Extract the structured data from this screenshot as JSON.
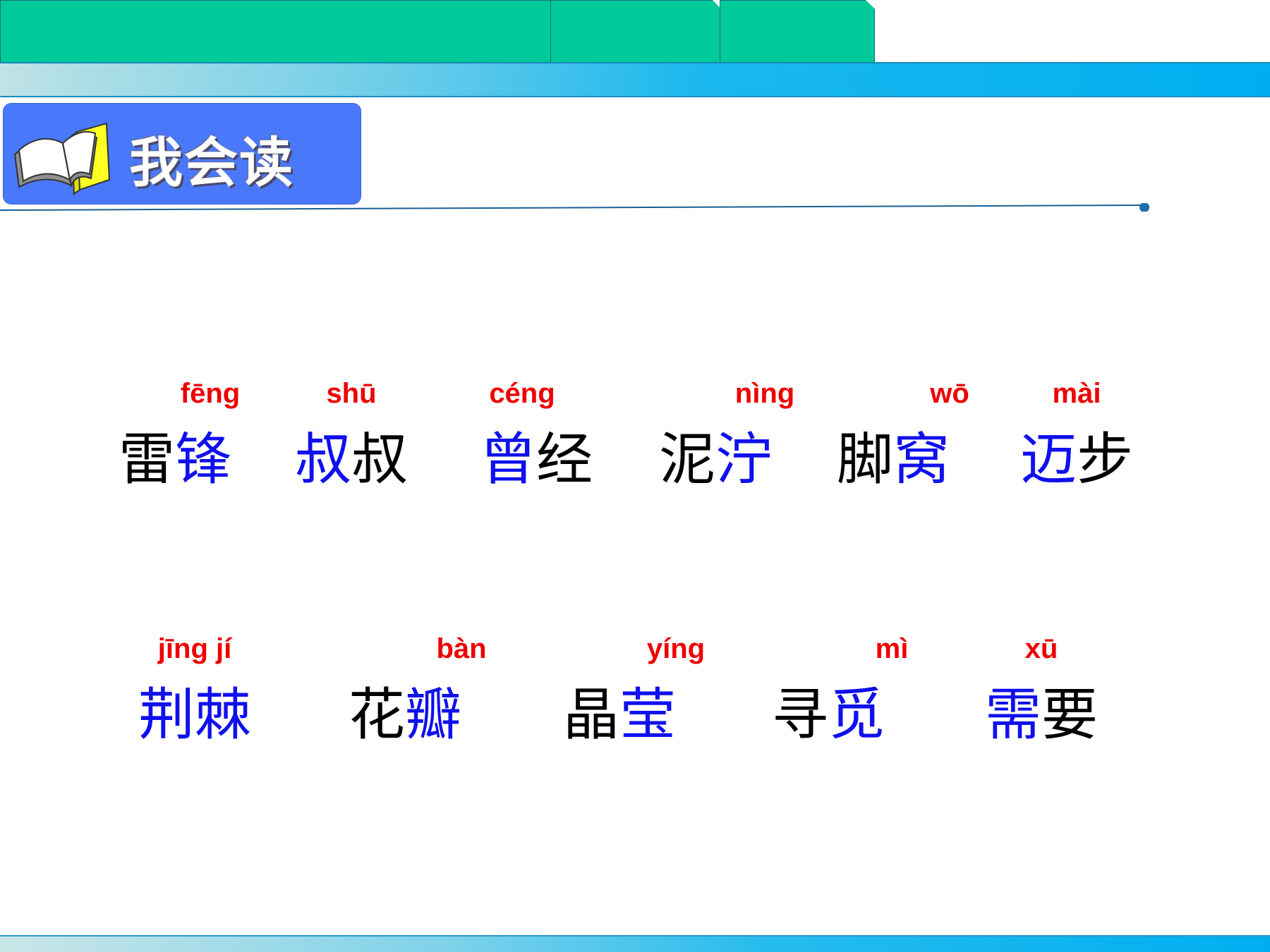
{
  "header": {
    "title": "我会读",
    "colors": {
      "tab": "#00c99a",
      "bar": "#00aef0",
      "header_bg": "#4a78fb",
      "pinyin": "#ee0000",
      "new_char": "#1010ee"
    }
  },
  "rows": [
    [
      {
        "pinyin": "fēng",
        "chars": [
          {
            "t": "雷",
            "new": false
          },
          {
            "t": "锋",
            "new": true
          }
        ]
      },
      {
        "pinyin": "shū",
        "chars": [
          {
            "t": "叔",
            "new": true
          },
          {
            "t": "叔",
            "new": false
          }
        ]
      },
      {
        "pinyin": "céng",
        "chars": [
          {
            "t": "曾",
            "new": true
          },
          {
            "t": "经",
            "new": false
          }
        ]
      },
      {
        "pinyin": "nìng",
        "chars": [
          {
            "t": "泥",
            "new": false
          },
          {
            "t": "泞",
            "new": true
          }
        ]
      },
      {
        "pinyin": "wō",
        "chars": [
          {
            "t": "脚",
            "new": false
          },
          {
            "t": "窝",
            "new": true
          }
        ]
      },
      {
        "pinyin": "mài",
        "chars": [
          {
            "t": "迈",
            "new": true
          },
          {
            "t": "步",
            "new": false
          }
        ]
      }
    ],
    [
      {
        "pinyin": "jīng jí",
        "chars": [
          {
            "t": "荆",
            "new": true
          },
          {
            "t": "棘",
            "new": true
          }
        ]
      },
      {
        "pinyin": "bàn",
        "chars": [
          {
            "t": "花",
            "new": false
          },
          {
            "t": "瓣",
            "new": true
          }
        ]
      },
      {
        "pinyin": "yíng",
        "chars": [
          {
            "t": "晶",
            "new": false
          },
          {
            "t": "莹",
            "new": true
          }
        ]
      },
      {
        "pinyin": "mì",
        "chars": [
          {
            "t": "寻",
            "new": false
          },
          {
            "t": "觅",
            "new": true
          }
        ]
      },
      {
        "pinyin": "xū",
        "chars": [
          {
            "t": "需",
            "new": true
          },
          {
            "t": "要",
            "new": false
          }
        ]
      }
    ]
  ]
}
